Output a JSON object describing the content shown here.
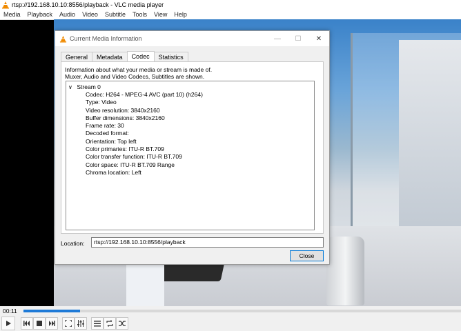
{
  "window": {
    "title": "rtsp://192.168.10.10:8556/playback - VLC media player"
  },
  "menu": [
    "Media",
    "Playback",
    "Audio",
    "Video",
    "Subtitle",
    "Tools",
    "View",
    "Help"
  ],
  "dialog": {
    "title": "Current Media Information",
    "tabs": [
      "General",
      "Metadata",
      "Codec",
      "Statistics"
    ],
    "active_tab": "Codec",
    "info_line1": "Information about what your media or stream is made of.",
    "info_line2": "Muxer, Audio and Video Codecs, Subtitles are shown.",
    "stream_name": "Stream 0",
    "stream_rows": [
      "Codec: H264 - MPEG-4 AVC (part 10) (h264)",
      "Type: Video",
      "Video resolution: 3840x2160",
      "Buffer dimensions: 3840x2160",
      "Frame rate: 30",
      "Decoded format:",
      "Orientation: Top left",
      "Color primaries: ITU-R BT.709",
      "Color transfer function: ITU-R BT.709",
      "Color space: ITU-R BT.709 Range",
      "Chroma location: Left"
    ],
    "location_label": "Location:",
    "location_value": "rtsp://192.168.10.10:8556/playback",
    "close_label": "Close"
  },
  "player": {
    "elapsed": "00:11",
    "progress_fraction": 0.13,
    "accent": "#1e7ad7"
  }
}
